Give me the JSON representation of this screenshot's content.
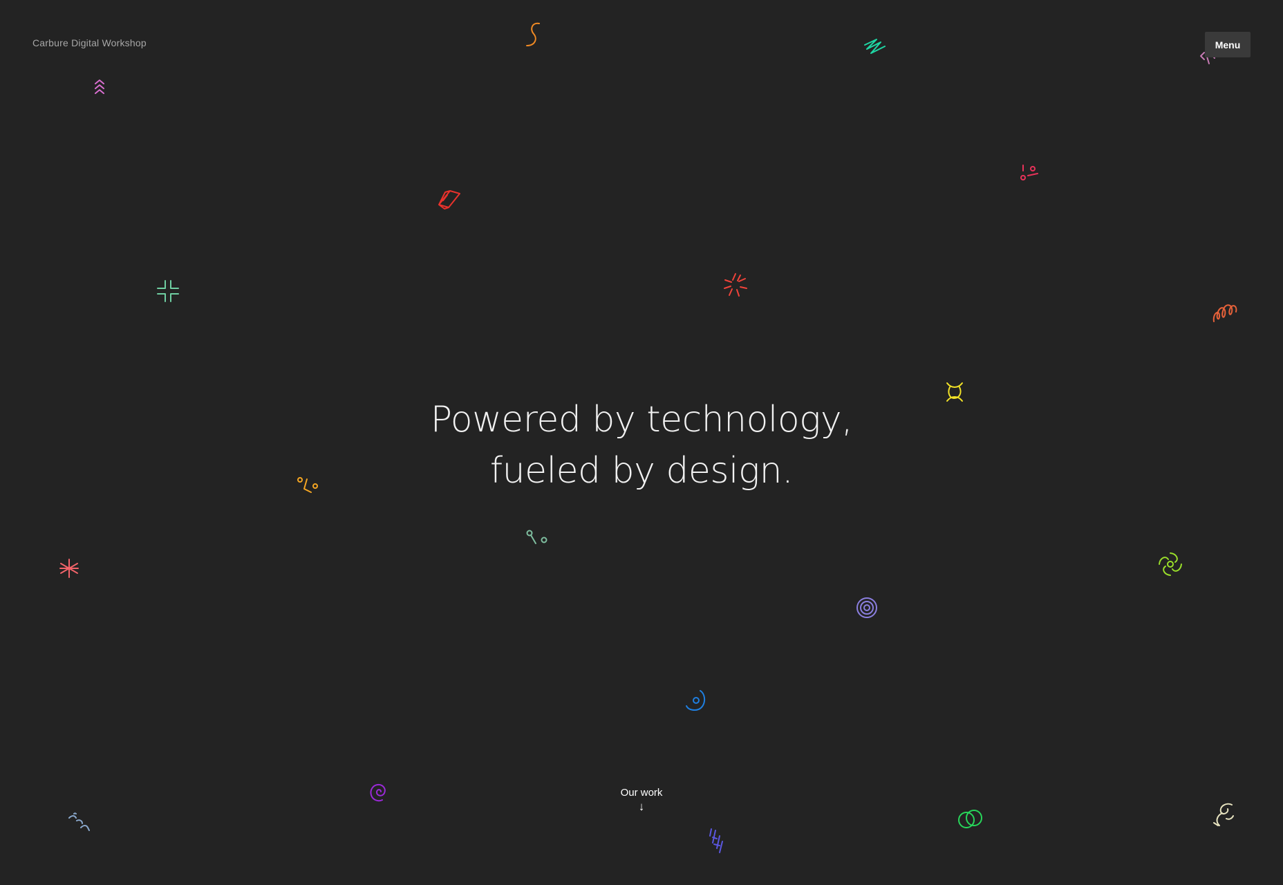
{
  "header": {
    "brand": "Carbure Digital Workshop",
    "menu_label": "Menu"
  },
  "hero": {
    "line1": "Powered by technology,",
    "line2": "fueled by design."
  },
  "scroll_cta": {
    "label": "Our work",
    "arrow": "↓"
  },
  "decorations": [
    {
      "name": "double-chevron-up-icon",
      "color": "#d96fd0"
    },
    {
      "name": "s-curve-icon",
      "color": "#f08a24"
    },
    {
      "name": "zigzag-icon",
      "color": "#1fd6a4"
    },
    {
      "name": "bracket-icon",
      "color": "#c77bb5"
    },
    {
      "name": "dots-dash-icon",
      "color": "#e8335a"
    },
    {
      "name": "prism-icon",
      "color": "#e8322c"
    },
    {
      "name": "corner-cross-icon",
      "color": "#6fcfa2"
    },
    {
      "name": "burst-icon",
      "color": "#f0433a"
    },
    {
      "name": "coil-icon",
      "color": "#e8623a"
    },
    {
      "name": "knot-icon",
      "color": "#f2e227"
    },
    {
      "name": "percent-icon",
      "color": "#f5a623"
    },
    {
      "name": "pin-dot-icon",
      "color": "#7fbfa0"
    },
    {
      "name": "asterisk-icon",
      "color": "#f2646a"
    },
    {
      "name": "pinwheel-icon",
      "color": "#9be02a"
    },
    {
      "name": "target-icon",
      "color": "#8b7fe0"
    },
    {
      "name": "dot-arc-icon",
      "color": "#1f7fe0"
    },
    {
      "name": "spiral-icon",
      "color": "#9b2ad9"
    },
    {
      "name": "hashes-icon",
      "color": "#5b57e0"
    },
    {
      "name": "birds-icon",
      "color": "#8aa8cc"
    },
    {
      "name": "overlap-circles-icon",
      "color": "#27d65a"
    },
    {
      "name": "swirl-icon",
      "color": "#e8e4c0"
    }
  ]
}
